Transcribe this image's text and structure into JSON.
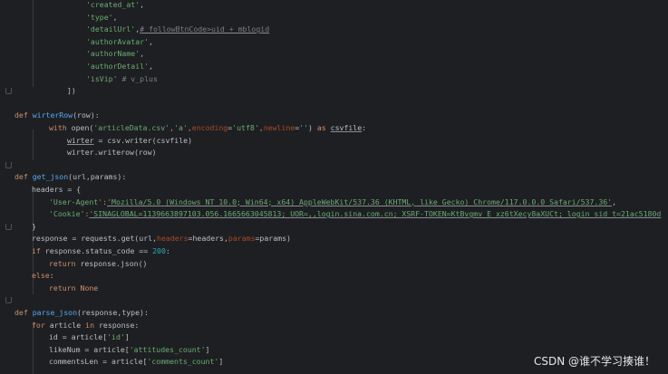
{
  "code": {
    "l1": {
      "s": "'created_at'",
      "p": ","
    },
    "l2": {
      "s": "'type'",
      "p": ","
    },
    "l3": {
      "s": "'detailUrl'",
      "p": ",",
      "c": "# followBtnCode>uid + mblogid"
    },
    "l4": {
      "s": "'authorAvatar'",
      "p": ","
    },
    "l5": {
      "s": "'authorName'",
      "p": ","
    },
    "l6": {
      "s": "'authorDetail'",
      "p": ","
    },
    "l7": {
      "s": "'isVip'",
      "c": "# v_plus"
    },
    "l8": {
      "t": "])"
    },
    "l10": {
      "kw": "def",
      "fn": "wirterRow",
      "sig": "(row):"
    },
    "l11": {
      "kw": "with",
      "a": "open(",
      "s1": "'articleData.csv'",
      "c1": ",",
      "s2": "'a'",
      "c2": ",",
      "p1": "encoding",
      "e1": "=",
      "s3": "'utf8'",
      "c3": ",",
      "p2": "newline",
      "e2": "=",
      "s4": "''",
      "b": ") ",
      "kw2": "as",
      "v": "csvfile",
      "end": ":"
    },
    "l12": {
      "v": "wirter",
      "t": " = csv.writer(csvfile)"
    },
    "l13": {
      "t": "wirter.writerow(row)"
    },
    "l15": {
      "kw": "def",
      "fn": "get_json",
      "sig": "(url,params):"
    },
    "l16": {
      "t": "headers = {"
    },
    "l17": {
      "s1": "'User-Agent'",
      "c": ":",
      "s2": "'Mozilla/5.0 (Windows NT 10.0; Win64; x64) AppleWebKit/537.36 (KHTML, like Gecko) Chrome/117.0.0.0 Safari/537.36'",
      "e": ","
    },
    "l18": {
      "s1": "'Cookie'",
      "c": ":",
      "s2": "'SINAGLOBAL=1139663897103.056.1665663045813; UOR=,,login.sina.com.cn; XSRF-TOKEN=KtBvgmv_E_xz6tXecy8aXUCt; login_sid_t=21ac5180d"
    },
    "l19": {
      "t": "}"
    },
    "l20": {
      "a": "response = requests.get(url,",
      "p1": "headers",
      "b": "=headers,",
      "p2": "params",
      "c": "=params)"
    },
    "l21": {
      "kw": "if",
      "a": " response.status_code == ",
      "n": "200",
      "e": ":"
    },
    "l22": {
      "kw": "return",
      "t": " response.json()"
    },
    "l23": {
      "kw": "else",
      "e": ":"
    },
    "l24": {
      "kw": "return",
      "kw2": "None"
    },
    "l26": {
      "kw": "def",
      "fn": "parse_json",
      "sig": "(response,type):"
    },
    "l27": {
      "kw": "for",
      "a": " article ",
      "kw2": "in",
      "b": " response:"
    },
    "l28": {
      "a": "id = article[",
      "s": "'id'",
      "b": "]"
    },
    "l29": {
      "a": "likeNum = article[",
      "s": "'attitudes_count'",
      "b": "]"
    },
    "l30": {
      "a": "commentsLen = article[",
      "s": "'comments_count'",
      "b": "]"
    }
  },
  "watermark": "CSDN @谁不学习揍谁！",
  "colors": {
    "background": "#1e1f22",
    "keyword": "#cf8e6d",
    "string": "#6aab73",
    "function": "#56a8f5",
    "number": "#2aacb8",
    "param": "#aa4926",
    "comment": "#7a7e85"
  }
}
